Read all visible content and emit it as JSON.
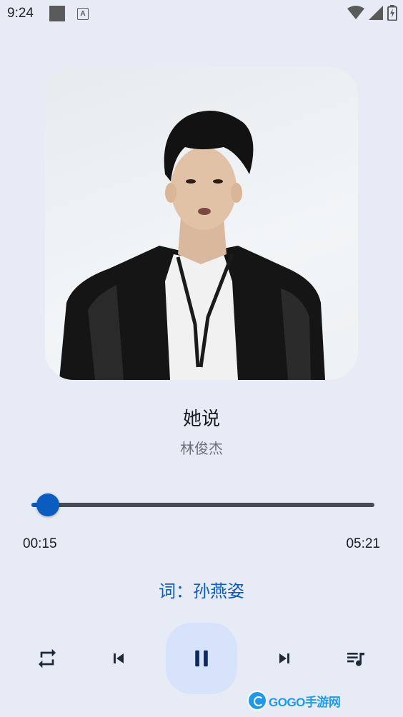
{
  "status_bar": {
    "time": "9:24"
  },
  "now_playing": {
    "title": "她说",
    "artist": "林俊杰",
    "current_time": "00:15",
    "total_time": "05:21",
    "progress_fraction": 0.047,
    "lyric_line": "词：孙燕姿"
  },
  "controls": {
    "repeat_icon": "repeat-icon",
    "previous_icon": "skip-previous-icon",
    "play_state_icon": "pause-icon",
    "next_icon": "skip-next-icon",
    "queue_icon": "queue-music-icon"
  },
  "watermark": {
    "text": "GOGO手游网"
  },
  "colors": {
    "accent": "#0b5cbf",
    "background": "#e6ebf6",
    "play_button_bg": "#d6e3fb",
    "track": "#474a55"
  }
}
